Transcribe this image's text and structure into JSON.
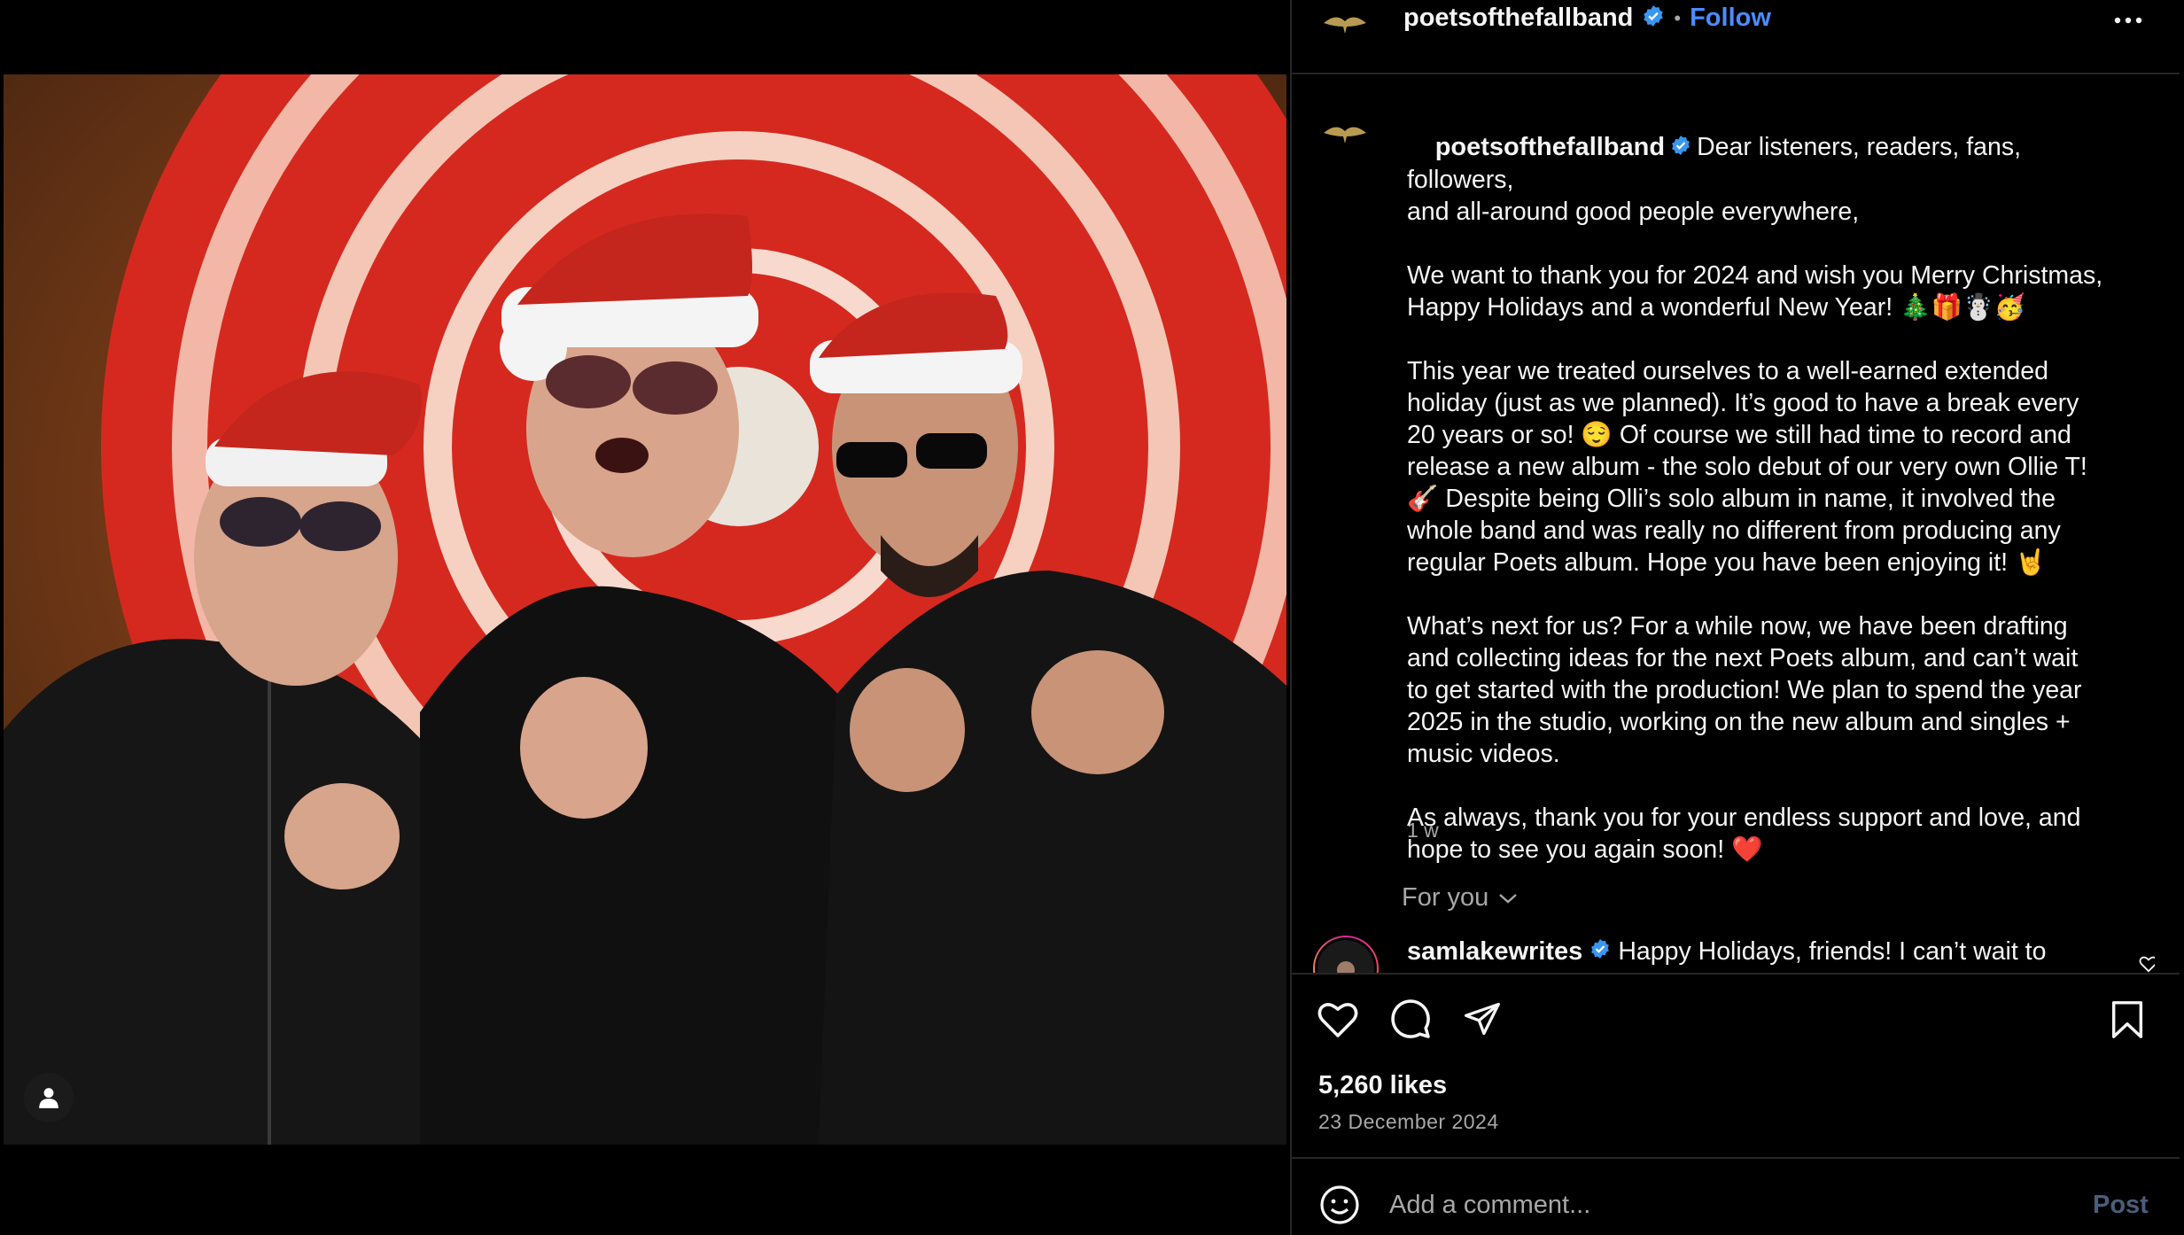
{
  "post": {
    "author": "poetsofthefallband",
    "follow_label": "Follow",
    "header_dot": "•",
    "caption_lines": [
      "Dear listeners, readers, fans, followers,",
      "and all-around good people everywhere,",
      "",
      "We want to thank you for 2024 and wish you Merry Christmas,",
      "Happy Holidays and a wonderful New Year! 🎄🎁☃️🥳",
      "",
      "This year we treated ourselves to a well-earned extended",
      "holiday (just as we planned). It’s good to have a break every",
      "20 years or so! 😌 Of course we still had time to record and",
      "release a new album - the solo debut of our very own Ollie T!",
      "🎸 Despite being Olli’s solo album in name, it involved the",
      "whole band and was really no different from producing any",
      "regular Poets album. Hope you have been enjoying it! 🤘",
      "",
      "What’s next for us? For a while now, we have been drafting",
      "and collecting ideas for the next Poets album, and can’t wait",
      "to get started with the production! We plan to spend the year",
      "2025 in the studio, working on the new album and singles +",
      "music videos.",
      "",
      "As always, thank you for your endless support and love, and",
      "hope to see you again soon! ❤️"
    ],
    "relative_time": "1 w",
    "likes": "5,260 likes",
    "date": "23 December 2024"
  },
  "comments": {
    "filter_label": "For you",
    "items": [
      {
        "user": "samlakewrites",
        "text": "Happy Holidays, friends! I can’t wait to"
      }
    ]
  },
  "composer": {
    "placeholder": "Add a comment...",
    "post_label": "Post"
  },
  "icons": {
    "verified": "verified-badge-icon",
    "more": "more-options-icon",
    "like": "heart-icon",
    "comment": "comment-icon",
    "share": "share-icon",
    "save": "bookmark-icon",
    "emoji": "emoji-icon",
    "tag": "user-tag-icon"
  },
  "colors": {
    "link": "#4a8cff",
    "verified": "#3897f0",
    "secondary_text": "#a8a8a8",
    "divider": "#262626"
  }
}
